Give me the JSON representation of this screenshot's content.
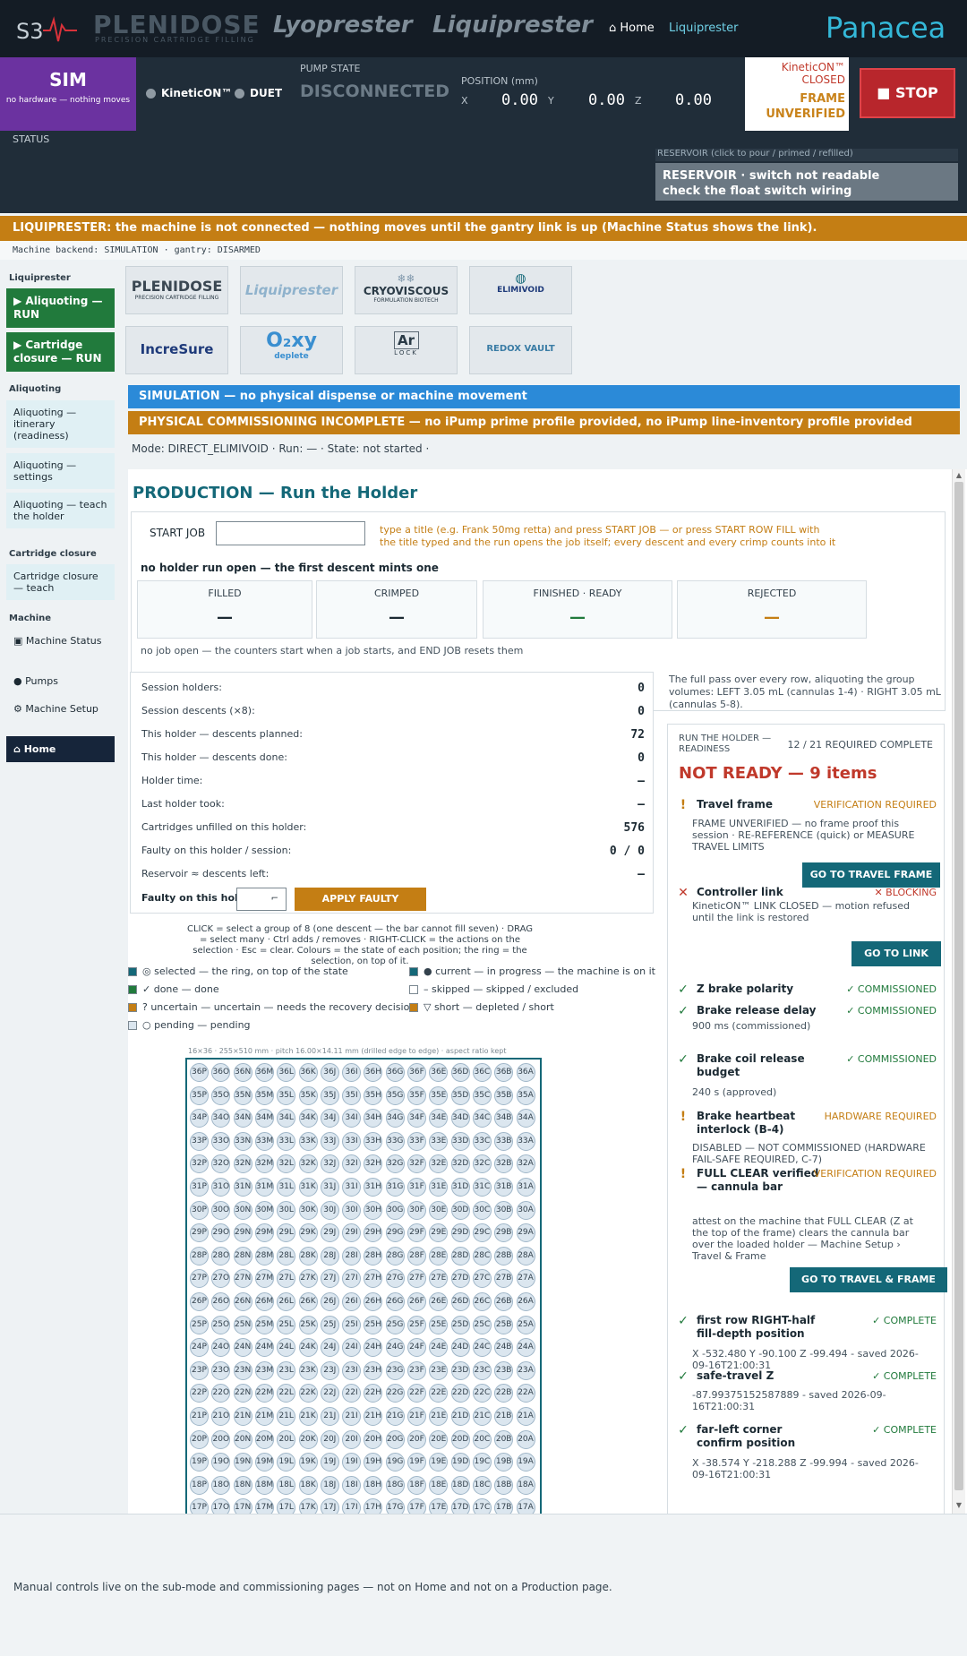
{
  "header": {
    "brand_plenidose": "PLENIDOSE",
    "brand_plenidose_sub": "PRECISION CARTRIDGE FILLING",
    "brand_lyoprester": "Lyoprester",
    "brand_liquiprester": "Liquiprester",
    "nav_home": "⌂ Home",
    "nav_liquiprester": "Liquiprester",
    "brand_panacea": "Panacea"
  },
  "status": {
    "sim_title": "SIM",
    "sim_sub": "no hardware — nothing moves",
    "kinetic_label": "KineticON™",
    "duet_label": "DUET",
    "pump_state_label": "PUMP STATE",
    "pump_state_value": "DISCONNECTED",
    "position_label": "POSITION (mm)",
    "x_label": "X",
    "x_value": "0.00",
    "y_label": "Y",
    "y_value": "0.00",
    "z_label": "Z",
    "z_value": "0.00",
    "kinetic_closed": "KineticON™ CLOSED",
    "frame_line1": "FRAME",
    "frame_line2": "UNVERIFIED",
    "stop_label": "■ STOP",
    "status_label": "STATUS",
    "reservoir_label": "RESERVOIR  (click to pour / primed / refilled)",
    "reservoir_line1": "RESERVOIR · switch not readable",
    "reservoir_line2": "check the float switch wiring"
  },
  "warning_bar": "LIQUIPRESTER: the machine is not connected — nothing moves until the gantry link is up (Machine Status shows the link).",
  "backend_line": "Machine backend: SIMULATION  ·  gantry: DISARMED",
  "sidebar": {
    "sec_liquiprester": "Liquiprester",
    "btn_aliquoting_run": "▶ Aliquoting — RUN",
    "btn_closure_run": "▶ Cartridge closure — RUN",
    "sec_aliquoting": "Aliquoting",
    "itinerary": "Aliquoting — itinerary (readiness)",
    "settings": "Aliquoting — settings",
    "teach_holder": "Aliquoting — teach the holder",
    "sec_closure": "Cartridge closure",
    "closure_teach": "Cartridge closure — teach",
    "sec_machine": "Machine",
    "machine_status": "▣ Machine Status",
    "pumps": "● Pumps",
    "machine_setup": "⚙ Machine Setup",
    "home": "⌂ Home"
  },
  "logos": {
    "plenidose": "PLENIDOSE",
    "plenidose_sub": "PRECISION CARTRIDGE FILLING",
    "liquiprester": "Liquiprester",
    "cryoviscous": "CRYOVISCOUS",
    "cryoviscous_sub": "FORMULATION BIOTECH",
    "elimivoid": "ELIMIVOID",
    "incresure": "IncreSure",
    "oxy": "O₂xy",
    "oxy_sub": "deplete",
    "ar": "Ar",
    "ar_sub": "LOCK",
    "redox": "REDOX VAULT"
  },
  "banners": {
    "simulation": "SIMULATION — no physical dispense or machine movement",
    "commissioning": "PHYSICAL COMMISSIONING INCOMPLETE — no iPump prime profile provided, no iPump line-inventory profile provided"
  },
  "mode_line": "Mode: DIRECT_ELIMIVOID  ·  Run: —  ·  State: not started  ·",
  "production": {
    "title": "PRODUCTION — Run the Holder",
    "start_job_label": "START JOB",
    "start_job_hint": "type a title (e.g. Frank 50mg retta) and press START JOB — or press START ROW FILL with the title typed and the run opens the job itself; every descent and every crimp counts into it",
    "no_holder": "no holder run open — the first descent mints one",
    "counters": [
      {
        "label": "FILLED",
        "value": "—",
        "color": "#1c2a33"
      },
      {
        "label": "CRIMPED",
        "value": "—",
        "color": "#1c2a33"
      },
      {
        "label": "FINISHED · READY",
        "value": "—",
        "color": "#217a3c"
      },
      {
        "label": "REJECTED",
        "value": "—",
        "color": "#c47e14"
      }
    ],
    "no_job": "no job open — the counters start when a job starts, and END JOB resets them"
  },
  "stats": [
    {
      "label": "Session holders:",
      "value": "0"
    },
    {
      "label": "Session descents (×8):",
      "value": "0"
    },
    {
      "label": "This holder — descents planned:",
      "value": "72"
    },
    {
      "label": "This holder — descents done:",
      "value": "0"
    },
    {
      "label": "Holder time:",
      "value": "—"
    },
    {
      "label": "Last holder took:",
      "value": "—"
    },
    {
      "label": "Cartridges unfilled on this holder:",
      "value": "576"
    },
    {
      "label": "Faulty on this holder / session:",
      "value": "0 / 0"
    },
    {
      "label": "Reservoir ≈ descents left:",
      "value": "—"
    }
  ],
  "faulty": {
    "label": "Faulty on this holder:",
    "apply": "APPLY FAULTY DEDUCTION"
  },
  "click_help": "CLICK = select a group of 8 (one descent — the bar cannot fill seven) · DRAG = select many · Ctrl adds / removes · RIGHT-CLICK = the actions on the selection · Esc = clear. Colours = the state of each position; the ring = the selection, on top of it.",
  "legend": [
    {
      "label": "◎ selected — the ring, on top of the state",
      "color": "#146878"
    },
    {
      "label": "● current — in progress — the machine is on it",
      "color": "#146878"
    },
    {
      "label": "✓ done — done",
      "color": "#217a3c"
    },
    {
      "label": "– skipped — skipped / excluded",
      "color": "#ffffff"
    },
    {
      "label": "? uncertain — uncertain — needs the recovery decision",
      "color": "#c47e14"
    },
    {
      "label": "▽ short — depleted / short",
      "color": "#c47e14"
    },
    {
      "label": "○ pending — pending",
      "color": "#dbe6ef"
    }
  ],
  "grid": {
    "caption": "16×36 · 255×510 mm · pitch 16.00×14.11 mm (drilled edge to edge) · aspect ratio kept",
    "columns": [
      "P",
      "O",
      "N",
      "M",
      "L",
      "K",
      "J",
      "I",
      "H",
      "G",
      "F",
      "E",
      "D",
      "C",
      "B",
      "A"
    ],
    "rows": [
      36,
      35,
      34,
      33,
      32,
      31,
      30,
      29,
      28,
      27,
      26,
      25,
      24,
      23,
      22,
      21,
      20,
      19,
      18,
      17
    ]
  },
  "readiness": {
    "full_pass": "The full pass over every row, aliquoting the group volumes: LEFT 3.05 mL (cannulas 1-4) · RIGHT 3.05 mL (cannulas 5-8).",
    "header_left": "RUN THE HOLDER — READINESS",
    "header_right": "12 / 21 REQUIRED COMPLETE",
    "not_ready": "NOT READY — 9 items",
    "items": [
      {
        "mark": "!",
        "mark_color": "#c47e14",
        "name": "Travel frame",
        "badge": "VERIFICATION REQUIRED",
        "badge_color": "#c47e14",
        "desc": "FRAME UNVERIFIED — no frame proof this session · RE-REFERENCE (quick) or MEASURE TRAVEL LIMITS",
        "button": "GO TO TRAVEL FRAME"
      },
      {
        "mark": "✕",
        "mark_color": "#c0392b",
        "name": "Controller link",
        "badge": "✕ BLOCKING",
        "badge_color": "#c0392b",
        "desc": "KineticON™ LINK CLOSED — motion refused until the link is restored",
        "button": "GO TO LINK"
      },
      {
        "mark": "✓",
        "mark_color": "#217a3c",
        "name": "Z brake polarity",
        "badge": "✓ COMMISSIONED",
        "badge_color": "#217a3c",
        "desc": "",
        "button": ""
      },
      {
        "mark": "✓",
        "mark_color": "#217a3c",
        "name": "Brake release delay",
        "badge": "✓ COMMISSIONED",
        "badge_color": "#217a3c",
        "desc": "900 ms (commissioned)",
        "button": ""
      },
      {
        "mark": "✓",
        "mark_color": "#217a3c",
        "name": "Brake coil release budget",
        "badge": "✓ COMMISSIONED",
        "badge_color": "#217a3c",
        "desc": "240 s (approved)",
        "button": ""
      },
      {
        "mark": "!",
        "mark_color": "#c47e14",
        "name": "Brake heartbeat interlock (B-4)",
        "badge": "HARDWARE REQUIRED",
        "badge_color": "#c47e14",
        "desc": "DISABLED — NOT COMMISSIONED (HARDWARE FAIL-SAFE REQUIRED, C-7)",
        "button": ""
      },
      {
        "mark": "!",
        "mark_color": "#c47e14",
        "name": "FULL CLEAR verified — cannula bar",
        "badge": "VERIFICATION REQUIRED",
        "badge_color": "#c47e14",
        "desc": "attest on the machine that FULL CLEAR (Z at the top of the frame) clears the cannula bar over the loaded holder — Machine Setup › Travel & Frame",
        "button": "GO TO TRAVEL & FRAME"
      },
      {
        "mark": "✓",
        "mark_color": "#217a3c",
        "name": "first row RIGHT-half fill-depth position",
        "badge": "✓ COMPLETE",
        "badge_color": "#217a3c",
        "desc": "X -532.480 Y -90.100 Z -99.494 - saved 2026-09-16T21:00:31",
        "button": ""
      },
      {
        "mark": "✓",
        "mark_color": "#217a3c",
        "name": "safe-travel Z",
        "badge": "✓ COMPLETE",
        "badge_color": "#217a3c",
        "desc": "-87.99375152587889 - saved 2026-09-16T21:00:31",
        "button": ""
      },
      {
        "mark": "✓",
        "mark_color": "#217a3c",
        "name": "far-left corner confirm position",
        "badge": "✓ COMPLETE",
        "badge_color": "#217a3c",
        "desc": "X -38.574 Y -218.288 Z -99.994 - saved 2026-09-16T21:00:31",
        "button": ""
      }
    ]
  },
  "footer": "Manual controls live on the sub-mode and commissioning pages — not on Home and not on a Production page."
}
